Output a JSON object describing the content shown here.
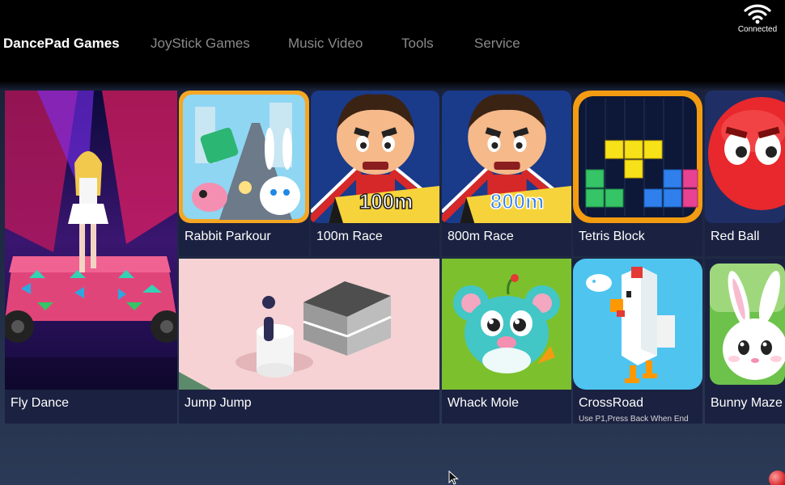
{
  "nav": {
    "tabs": [
      {
        "label": "DancePad Games",
        "active": true
      },
      {
        "label": "JoyStick Games",
        "active": false
      },
      {
        "label": "Music Video",
        "active": false
      },
      {
        "label": "Tools",
        "active": false
      },
      {
        "label": "Service",
        "active": false
      }
    ]
  },
  "status": {
    "connection_label": "Connected",
    "icon": "wifi-icon"
  },
  "games": [
    {
      "title": "Fly Dance"
    },
    {
      "title": "Rabbit Parkour"
    },
    {
      "title": "100m Race",
      "art_text": "100m"
    },
    {
      "title": "800m Race",
      "art_text": "800m"
    },
    {
      "title": "Tetris Block"
    },
    {
      "title": "Red Ball"
    },
    {
      "title": "Jump Jump"
    },
    {
      "title": "Whack Mole"
    },
    {
      "title": "CrossRoad",
      "subtitle": "Use P1,Press Back When End"
    },
    {
      "title": "Bunny Maze"
    }
  ],
  "colors": {
    "background": "#000000",
    "tile_bg": "#1b2140",
    "active_tab": "#ffffff",
    "inactive_tab": "#8a8a8a"
  }
}
